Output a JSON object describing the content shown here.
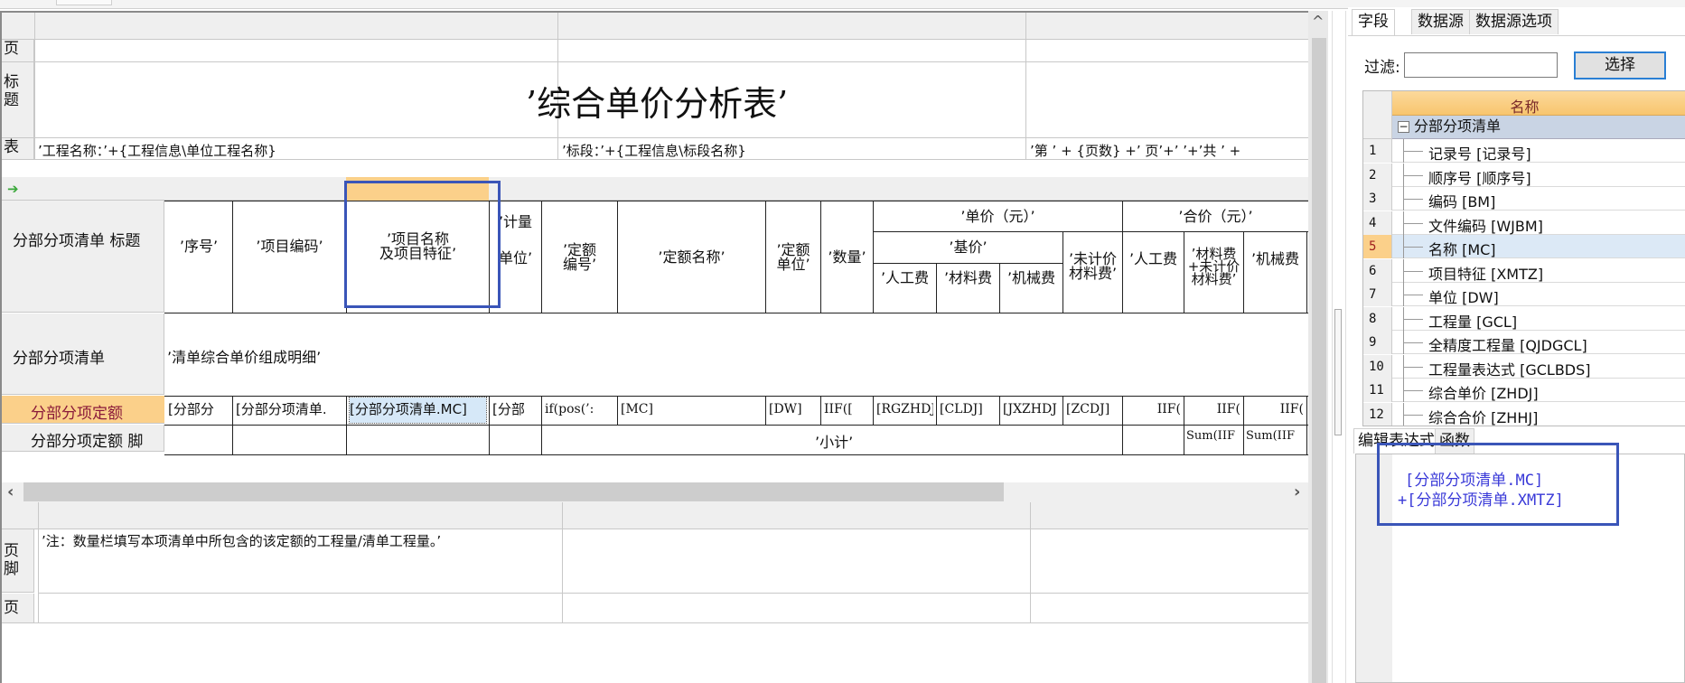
{
  "designer": {
    "bands": {
      "page_header": "页",
      "title": "标题",
      "table_header": "表",
      "footer": "页脚",
      "page_footer": "页"
    },
    "report_title": "’综合单价分析表’",
    "project_name_expr": "’工程名称：’+{工程信息\\单位工程名称}",
    "section_expr": "’标段：’+{工程信息\\标段名称}",
    "page_expr": "’第 ’ + {页数} +’ 页’+’  ’+’共 ’ +",
    "column_headers": {
      "xuhao": "’序号’",
      "xiangmubianma": "’项目编码’",
      "xiangmumingcheng": "’项目名称\n及项目特征’",
      "jiliang_danwei": "’计量\n单位’",
      "dinge_bianhao": "’定额\n编号’",
      "dinge_mingcheng": "’定额名称’",
      "dinge_danwei": "’定额\n单位’",
      "shuliang": "’数量’",
      "danjia_group": "’单价（元）’",
      "jijia_group": "’基价’",
      "rengongfei": "’人工费",
      "cailiaofei": "’材料费",
      "jixiefei": "’机械费",
      "weijijia_cailiaofei": "’未计价\n材料费’",
      "hejia_group": "’合价（元）’",
      "hejia_rengongfei": "’人工费",
      "hejia_cailiaofei": "’材料费\n+未计价\n材料费’",
      "hejia_jixiefei": "’机械费"
    },
    "rows": {
      "list_title": "分部分项清单  标题",
      "list_detail": "分部分项清单",
      "list_detail_value": "’清单综合单价组成明细’",
      "quota": "分部分项定额",
      "quota_footer": "分部分项定额 脚"
    },
    "quota_cells": [
      "[分部分",
      "[分部分项清单.",
      "[分部分项清单.MC]",
      "[分部",
      "if(pos(’:",
      "[MC]",
      "[DW]",
      "IIF([",
      "[RGZHDJ",
      "[CLDJ]",
      "[JXZHDJ",
      "[ZCDJ]",
      "IIF(",
      "IIF(",
      "IIF("
    ],
    "quota_footer_cells": {
      "subtotal": "’小计’",
      "sum1": "Sum(IIF",
      "sum2": "Sum(IIF"
    },
    "footer_note": "’注：数量栏填写本项清单中所包含的该定额的工程量/清单工程量。’",
    "scroll": {
      "left_arrow": "‹",
      "right_arrow": "›",
      "up_arrow": "^"
    }
  },
  "right_panel": {
    "tabs": [
      {
        "label": "字段",
        "active": true
      },
      {
        "label": "数据源",
        "active": false
      },
      {
        "label": "数据源选项",
        "active": false
      }
    ],
    "filter_label": "过滤:",
    "filter_value": "",
    "select_button": "选择",
    "grid_header": "名称",
    "group_name": "分部分项清单",
    "group_toggle": "−",
    "fields": [
      {
        "num": "1",
        "label": "记录号 [记录号]"
      },
      {
        "num": "2",
        "label": "顺序号 [顺序号]"
      },
      {
        "num": "3",
        "label": "编码 [BM]"
      },
      {
        "num": "4",
        "label": "文件编码 [WJBM]"
      },
      {
        "num": "5",
        "label": "名称 [MC]",
        "selected": true
      },
      {
        "num": "6",
        "label": "项目特征 [XMTZ]"
      },
      {
        "num": "7",
        "label": "单位 [DW]"
      },
      {
        "num": "8",
        "label": "工程量 [GCL]"
      },
      {
        "num": "9",
        "label": "全精度工程量 [QJDGCL]"
      },
      {
        "num": "10",
        "label": "工程量表达式 [GCLBDS]"
      },
      {
        "num": "11",
        "label": "综合单价 [ZHDJ]"
      },
      {
        "num": "12",
        "label": "综合合价 [ZHHJ]"
      }
    ],
    "expr_tabs": [
      {
        "label": "编辑表达式",
        "active": true
      },
      {
        "label": "函数",
        "active": false
      }
    ],
    "expression_lines": [
      "[分部分项清单.MC]",
      "+[分部分项清单.XMTZ]"
    ]
  },
  "colors": {
    "selected_header": "#fbd08a",
    "quota_row_label": "#fbd08a",
    "quota_row_text": "#8a1a3a",
    "highlight_box": "#3a55b8",
    "expression_text": "#3a3ad8",
    "selected_cell": "#d6e8f8"
  }
}
